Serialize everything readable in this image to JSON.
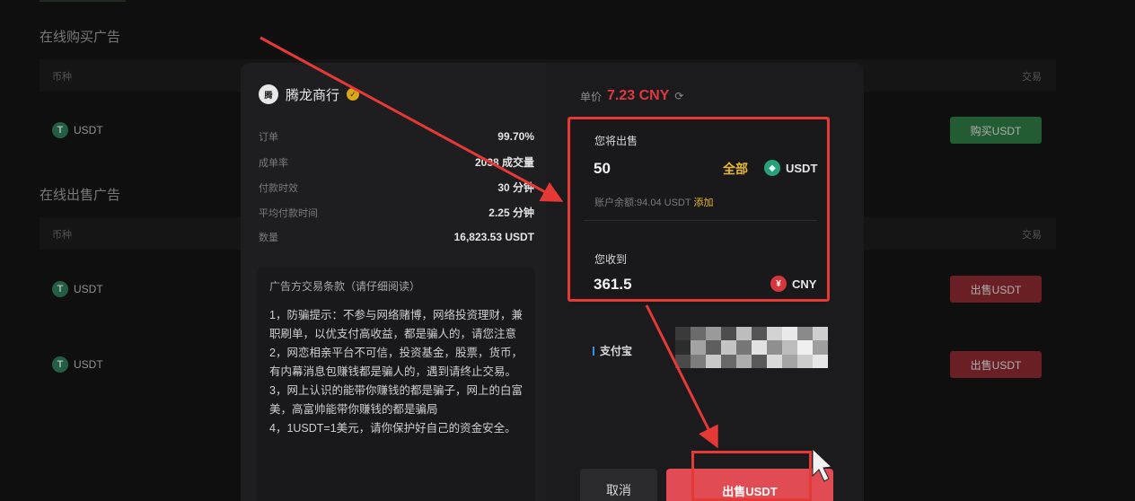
{
  "background": {
    "buy_section_title": "在线购买广告",
    "sell_section_title": "在线出售广告",
    "col_coin": "币种",
    "col_trade": "交易",
    "buy_rows": [
      {
        "coin": "USDT",
        "action": "购买USDT"
      }
    ],
    "sell_rows": [
      {
        "coin": "USDT",
        "action": "出售USDT"
      },
      {
        "coin": "USDT",
        "action": "出售USDT"
      }
    ]
  },
  "merchant": {
    "name": "腾龙商行",
    "stats": [
      {
        "label": "订单",
        "value": "99.70%"
      },
      {
        "label": "成单率",
        "value": "2038 成交量"
      },
      {
        "label": "付款时效",
        "value": "30 分钟"
      },
      {
        "label": "平均付款时间",
        "value": "2.25 分钟"
      },
      {
        "label": "数量",
        "value": "16,823.53 USDT"
      }
    ]
  },
  "terms": {
    "title": "广告方交易条款（请仔细阅读）",
    "body": "1，防骗提示：不参与网络赌博，网络投资理财，兼职刷单，以优支付高收益，都是骗人的，请您注意\n2，网恋相亲平台不可信，投资基金，股票，货币，有内幕消息包赚钱都是骗人的，遇到请终止交易。\n3，网上认识的能带你赚钱的都是骗子，网上的白富美，高富帅能带你赚钱的都是骗局\n4，1USDT=1美元，请你保护好自己的资金安全。"
  },
  "order": {
    "price_label": "单价",
    "price_value": "7.23 CNY",
    "sell_label": "您将出售",
    "sell_amount": "50",
    "all_label": "全部",
    "sell_currency": "USDT",
    "balance_text": "账户余额:94.04 USDT",
    "add_label": "添加",
    "receive_label": "您收到",
    "receive_amount": "361.5",
    "receive_currency": "CNY",
    "payment_method": "支付宝",
    "cancel_label": "取消",
    "confirm_label": "出售USDT"
  },
  "colors": {
    "sell_red": "#e04b54",
    "buy_green": "#2f7a45",
    "accent_gold": "#e8b72e",
    "annotation_red": "#e43935"
  }
}
